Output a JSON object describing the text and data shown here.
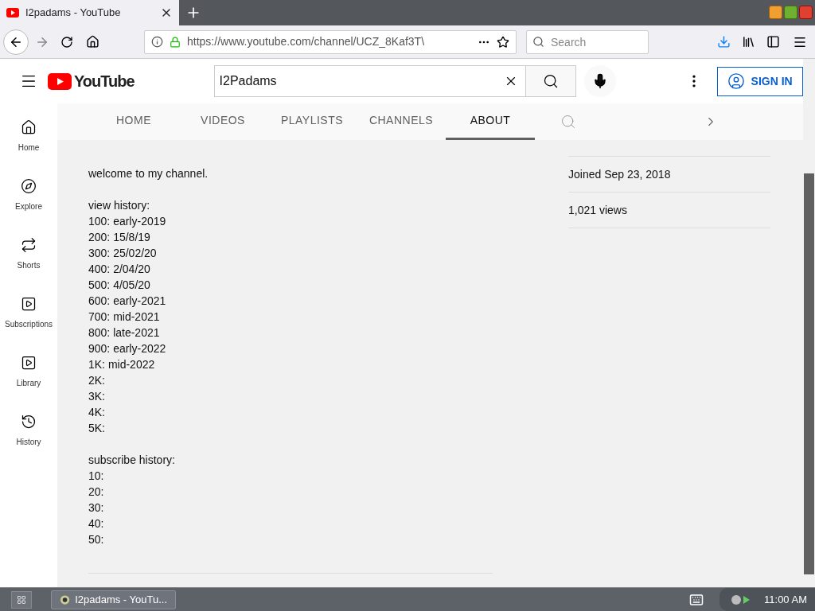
{
  "browser": {
    "tab_title": "I2padams - YouTube",
    "url": "https://www.youtube.com/channel/UCZ_8Kaf3T\\",
    "search_placeholder": "Search"
  },
  "header": {
    "logo": "YouTube",
    "search_value": "I2Padams",
    "sign_in": "SIGN IN"
  },
  "sidebar": [
    {
      "label": "Home"
    },
    {
      "label": "Explore"
    },
    {
      "label": "Shorts"
    },
    {
      "label": "Subscriptions"
    },
    {
      "label": "Library"
    },
    {
      "label": "History"
    }
  ],
  "channel_tabs": [
    {
      "label": "HOME",
      "selected": false
    },
    {
      "label": "VIDEOS",
      "selected": false
    },
    {
      "label": "PLAYLISTS",
      "selected": false
    },
    {
      "label": "CHANNELS",
      "selected": false
    },
    {
      "label": "ABOUT",
      "selected": true
    }
  ],
  "description": [
    [
      "welcome to my channel."
    ],
    [
      "view history:",
      "100: early-2019",
      "200: 15/8/19",
      "300: 25/02/20",
      "400: 2/04/20",
      "500: 4/05/20",
      "600: early-2021",
      "700: mid-2021",
      "800: late-2021",
      "900: early-2022",
      "1K: mid-2022",
      "2K:",
      "3K:",
      "4K:",
      "5K:"
    ],
    [
      "subscribe history:",
      "10:",
      "20:",
      "30:",
      "40:",
      "50:"
    ]
  ],
  "stats": [
    "Joined Sep 23, 2018",
    "1,021 views"
  ],
  "taskbar": {
    "window": "I2padams - YouTu...",
    "clock": "11:00 AM"
  }
}
